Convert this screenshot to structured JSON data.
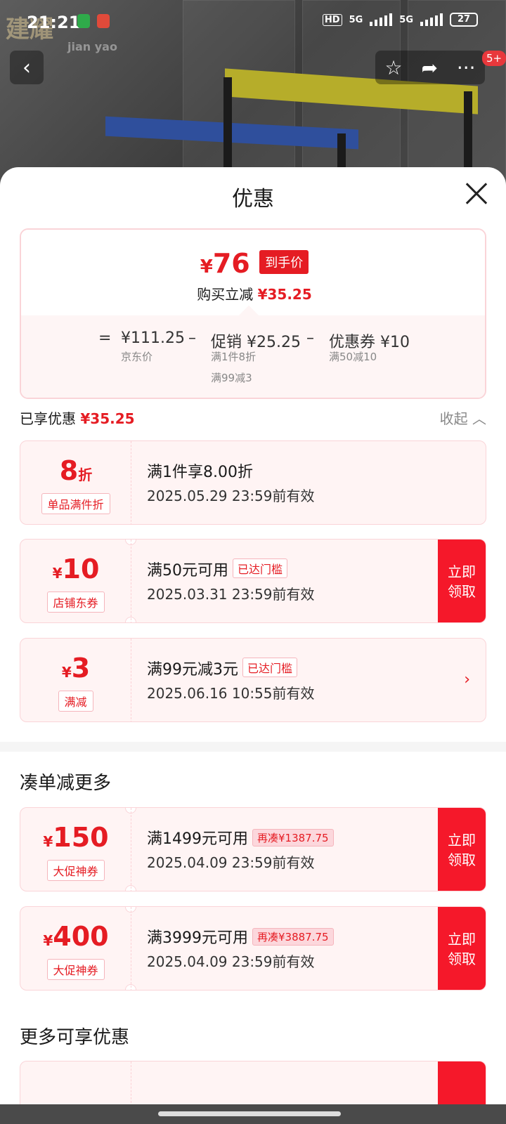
{
  "status": {
    "time": "21:21",
    "battery": "27",
    "net1": "5G",
    "net2": "5G",
    "hd": "HD"
  },
  "background": {
    "logo_cn": "建耀",
    "logo_en": "jian yao",
    "badge": "5+"
  },
  "sheet": {
    "title": "优惠"
  },
  "summary": {
    "currency": "¥",
    "final_price": "76",
    "final_tag": "到手价",
    "reduce_label": "购买立减",
    "reduce_value": "¥35.25",
    "eq_sign": "=",
    "jd_price": "¥111.25",
    "jd_label": "京东价",
    "minus1": "–",
    "promo": "促销 ¥25.25",
    "promo_sub1": "满1件8折",
    "promo_sub2": "满99减3",
    "minus2": "–",
    "coupon": "优惠券 ¥10",
    "coupon_sub": "满50减10"
  },
  "enjoyed": {
    "label": "已享优惠",
    "value": "¥35.25",
    "collapse": "收起"
  },
  "cards_enjoyed": [
    {
      "value": "8",
      "unit": "折",
      "label": "单品满件折",
      "cond": "满1件享8.00折",
      "pill": "",
      "expire": "2025.05.29 23:59前有效",
      "button": ""
    },
    {
      "currency": "¥",
      "value": "10",
      "label": "店铺东券",
      "cond": "满50元可用",
      "pill": "已达门槛",
      "expire": "2025.03.31 23:59前有效",
      "button": "立即领取"
    },
    {
      "currency": "¥",
      "value": "3",
      "label": "满减",
      "cond": "满99元减3元",
      "pill": "已达门槛",
      "expire": "2025.06.16 10:55前有效",
      "arrow": "›"
    }
  ],
  "section_more": "凑单减更多",
  "cards_more": [
    {
      "currency": "¥",
      "value": "150",
      "label": "大促神券",
      "cond": "满1499元可用",
      "pill": "再凑¥1387.75",
      "expire": "2025.04.09 23:59前有效",
      "button": "立即领取"
    },
    {
      "currency": "¥",
      "value": "400",
      "label": "大促神券",
      "cond": "满3999元可用",
      "pill": "再凑¥3887.75",
      "expire": "2025.04.09 23:59前有效",
      "button": "立即领取"
    }
  ],
  "section_extra": "更多可享优惠",
  "colors": {
    "accent": "#e51c23",
    "button": "#f5182a",
    "card_bg": "#fff4f4"
  }
}
